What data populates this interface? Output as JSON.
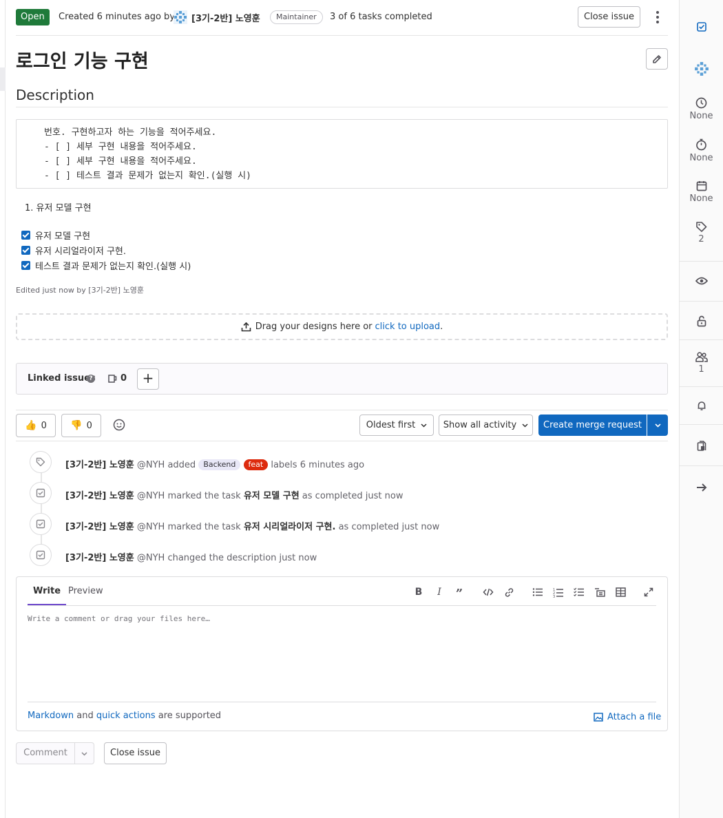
{
  "header": {
    "status": "Open",
    "created_text": "Created 6 minutes ago by",
    "author": "[3기-2반] 노영훈",
    "role": "Maintainer",
    "tasks": "3 of 6 tasks completed",
    "close_label": "Close issue"
  },
  "issue": {
    "title": "로그인 기능 구현",
    "description_heading": "Description",
    "code_lines": [
      "번호. 구현하고자 하는 기능을 적어주세요.",
      "- [ ] 세부 구현 내용을 적어주세요.",
      "- [ ] 세부 구현 내용을 적어주세요.",
      "- [ ] 테스트 결과 문제가 없는지 확인.(실행 시)"
    ],
    "ordered_item": "1. 유저 모델 구현",
    "tasks": [
      {
        "label": "유저 모델 구현",
        "checked": true
      },
      {
        "label": "유저 시리얼라이저 구현.",
        "checked": true
      },
      {
        "label": "테스트 결과 문제가 없는지 확인.(실행 시)",
        "checked": true
      }
    ],
    "edited": "Edited just now by [3기-2반] 노영훈"
  },
  "design_upload": {
    "text": "Drag your designs here or",
    "link": "click to upload",
    "end": "."
  },
  "linked_issues": {
    "title": "Linked issues",
    "help": "?",
    "count": "0",
    "add_label": "+"
  },
  "actions": {
    "thumbs_up": "0",
    "thumbs_down": "0",
    "sort_label": "Oldest first",
    "filter_label": "Show all activity",
    "mr_label": "Create merge request"
  },
  "timeline": [
    {
      "icon": "label-icon",
      "author": "[3기-2반] 노영훈",
      "handle": "@NYH",
      "pre": "added",
      "labels": [
        "Backend",
        "feat"
      ],
      "post": "labels 6 minutes ago"
    },
    {
      "icon": "task-done-icon",
      "author": "[3기-2반] 노영훈",
      "handle": "@NYH",
      "pre": "marked the task",
      "task": "유저 모델 구현",
      "post": "as completed just now"
    },
    {
      "icon": "task-done-icon",
      "author": "[3기-2반] 노영훈",
      "handle": "@NYH",
      "pre": "marked the task",
      "task": "유저 시리얼라이저 구현.",
      "post": "as completed just now"
    },
    {
      "icon": "task-done-icon",
      "author": "[3기-2반] 노영훈",
      "handle": "@NYH",
      "pre": "changed the description just now"
    }
  ],
  "comment": {
    "tab_write": "Write",
    "tab_preview": "Preview",
    "placeholder": "Write a comment or drag your files here…",
    "markdown": "Markdown",
    "and": "and",
    "quick_actions": "quick actions",
    "supported": "are supported",
    "attach": "Attach a file",
    "comment_btn": "Comment",
    "close_btn": "Close issue"
  },
  "sidebar": {
    "time_estimate": "None",
    "time_spent": "None",
    "due_date": "None",
    "labels_count": "2",
    "participants": "1"
  },
  "colors": {
    "open_badge": "#1f7a3a",
    "primary": "#1068bf",
    "feat_label": "#dd2b0e",
    "backend_label": "#e9e8f7",
    "tab_active": "#6e49cb"
  }
}
